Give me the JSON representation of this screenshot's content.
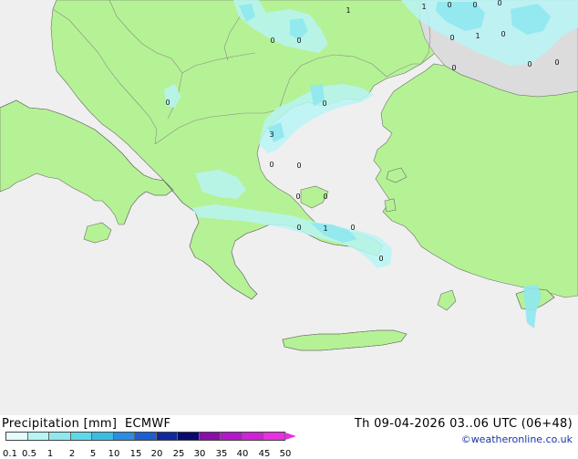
{
  "header": {
    "title": "Precipitation [mm]",
    "model": "ECMWF",
    "valid_time": "Th 09-04-2026 03..06 UTC (06+48)",
    "credit": "©weatheronline.co.uk"
  },
  "legend": {
    "labels": [
      "0.1",
      "0.5",
      "1",
      "2",
      "5",
      "10",
      "15",
      "20",
      "25",
      "30",
      "35",
      "40",
      "45",
      "50"
    ],
    "colors": [
      "#e6fcfc",
      "#b8f4f4",
      "#8ee8ee",
      "#5ed8e6",
      "#3cbde0",
      "#2a8de0",
      "#1c5fd0",
      "#10289e",
      "#0a0a6e",
      "#8a0ea8",
      "#b418c8",
      "#d020d8",
      "#e830e0"
    ]
  },
  "map": {
    "colors": {
      "sea": "#efefef",
      "land": "#b5f295",
      "outside": "#dcdcdc",
      "border": "#8a8a8a",
      "coast": "#6c6c6c"
    },
    "point_labels": [
      "1",
      "1",
      "0",
      "0",
      "0",
      "1",
      "0",
      "0",
      "0",
      "0",
      "0",
      "0",
      "0",
      "0",
      "0",
      "3",
      "0",
      "0",
      "0",
      "0",
      "0",
      "1",
      "0",
      "0"
    ]
  }
}
